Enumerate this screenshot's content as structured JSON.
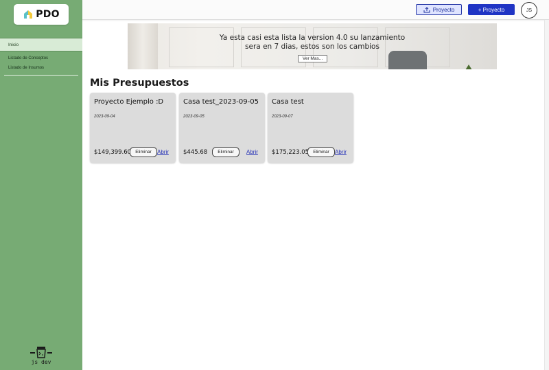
{
  "app": {
    "logo_text": "PDO"
  },
  "sidebar": {
    "active_item": "Inicio",
    "items": [
      "Listado de Conceptos",
      "Listado de Insumos"
    ],
    "footer_text": "js dev"
  },
  "header": {
    "upload_button": "Proyecto",
    "new_button": "+ Proyecto",
    "avatar_initials": "JS"
  },
  "banner": {
    "line1": "Ya esta casi esta lista la version 4.0 su lanzamiento",
    "line2": "sera en 7 dias, estos son los cambios",
    "button": "Ver Mas..."
  },
  "main": {
    "section_title": "Mis Presupuestos",
    "projects": [
      {
        "title": "Proyecto Ejemplo :D",
        "date": "2023-09-04",
        "amount": "$149,399.60",
        "delete_label": "Eliminar",
        "open_label": "Abrir"
      },
      {
        "title": "Casa test_2023-09-05",
        "date": "2023-09-05",
        "amount": "$445.68",
        "delete_label": "Eliminar",
        "open_label": "Abrir"
      },
      {
        "title": "Casa test",
        "date": "2023-09-07",
        "amount": "$175,223.05",
        "delete_label": "Eliminar",
        "open_label": "Abrir"
      }
    ]
  },
  "colors": {
    "sidebar": "#77ab74",
    "primary": "#1f34c4",
    "card": "#dcdcdc",
    "link": "#2a36b8"
  }
}
